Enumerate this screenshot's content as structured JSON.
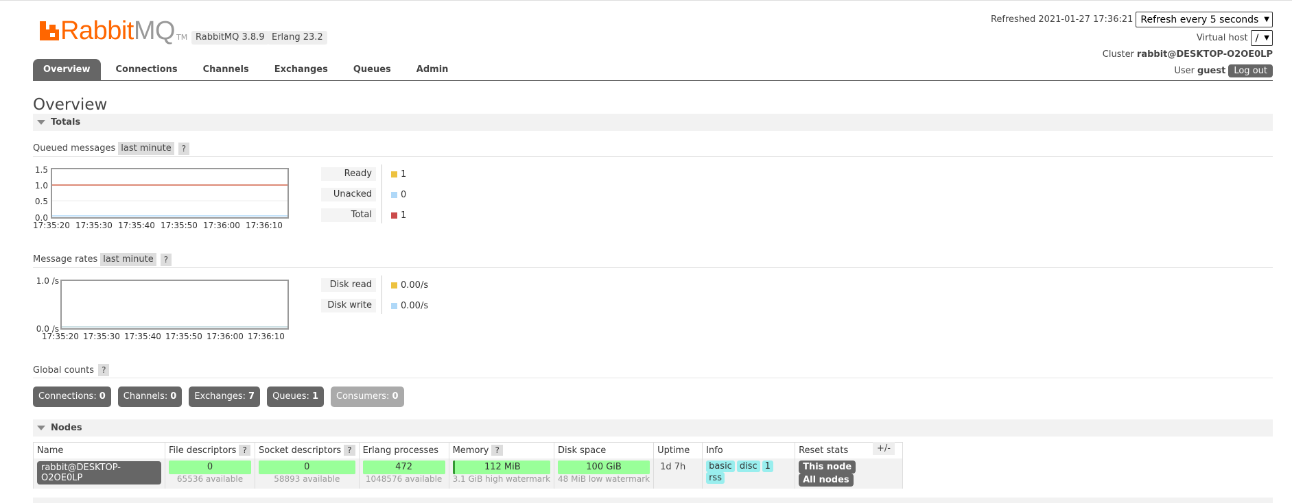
{
  "brand": {
    "rabbit": "Rabbit",
    "mq": "MQ",
    "tm": "TM"
  },
  "versions": {
    "rabbitmq": "RabbitMQ 3.8.9",
    "erlang": "Erlang 23.2"
  },
  "header": {
    "refreshed_label": "Refreshed",
    "refreshed_time": "2021-01-27 17:36:21",
    "refresh_option": "Refresh every 5 seconds",
    "vhost_label": "Virtual host",
    "vhost_value": "/",
    "cluster_label": "Cluster",
    "cluster_name": "rabbit@DESKTOP-O2OE0LP",
    "user_label": "User",
    "user_name": "guest",
    "logout": "Log out"
  },
  "tabs": [
    "Overview",
    "Connections",
    "Channels",
    "Exchanges",
    "Queues",
    "Admin"
  ],
  "page_title": "Overview",
  "totals": {
    "title": "Totals",
    "queued": {
      "label": "Queued messages",
      "range": "last minute",
      "help": "?",
      "y_ticks": [
        "1.5",
        "1.0",
        "0.5",
        "0.0"
      ],
      "x_ticks": [
        "17:35:20",
        "17:35:30",
        "17:35:40",
        "17:35:50",
        "17:36:00",
        "17:36:10"
      ],
      "legend": [
        {
          "label": "Ready",
          "value": "1",
          "color": "#edc240"
        },
        {
          "label": "Unacked",
          "value": "0",
          "color": "#afd8f8"
        },
        {
          "label": "Total",
          "value": "1",
          "color": "#cb4b4b"
        }
      ]
    },
    "rates": {
      "label": "Message rates",
      "range": "last minute",
      "help": "?",
      "y_ticks": [
        "1.0 /s",
        "0.0 /s"
      ],
      "x_ticks": [
        "17:35:20",
        "17:35:30",
        "17:35:40",
        "17:35:50",
        "17:36:00",
        "17:36:10"
      ],
      "legend": [
        {
          "label": "Disk read",
          "value": "0.00/s",
          "color": "#edc240"
        },
        {
          "label": "Disk write",
          "value": "0.00/s",
          "color": "#afd8f8"
        }
      ]
    }
  },
  "global_counts": {
    "label": "Global counts",
    "help": "?",
    "items": [
      {
        "label": "Connections:",
        "value": "0"
      },
      {
        "label": "Channels:",
        "value": "0"
      },
      {
        "label": "Exchanges:",
        "value": "7"
      },
      {
        "label": "Queues:",
        "value": "1"
      },
      {
        "label": "Consumers:",
        "value": "0"
      }
    ]
  },
  "nodes": {
    "title": "Nodes",
    "toggle": "+/-",
    "columns": [
      "Name",
      "File descriptors",
      "Socket descriptors",
      "Erlang processes",
      "Memory",
      "Disk space",
      "Uptime",
      "Info",
      "Reset stats"
    ],
    "help": "?",
    "row": {
      "name": "rabbit@DESKTOP-O2OE0LP",
      "fd": "0",
      "fd_sub": "65536 available",
      "sd": "0",
      "sd_sub": "58893 available",
      "ep": "472",
      "ep_sub": "1048576 available",
      "mem": "112 MiB",
      "mem_sub": "3.1 GiB high watermark",
      "disk": "100 GiB",
      "disk_sub": "48 MiB low watermark",
      "uptime": "1d 7h",
      "info": [
        "basic",
        "disc",
        "1",
        "rss"
      ],
      "reset": [
        "This node",
        "All nodes"
      ]
    }
  }
}
